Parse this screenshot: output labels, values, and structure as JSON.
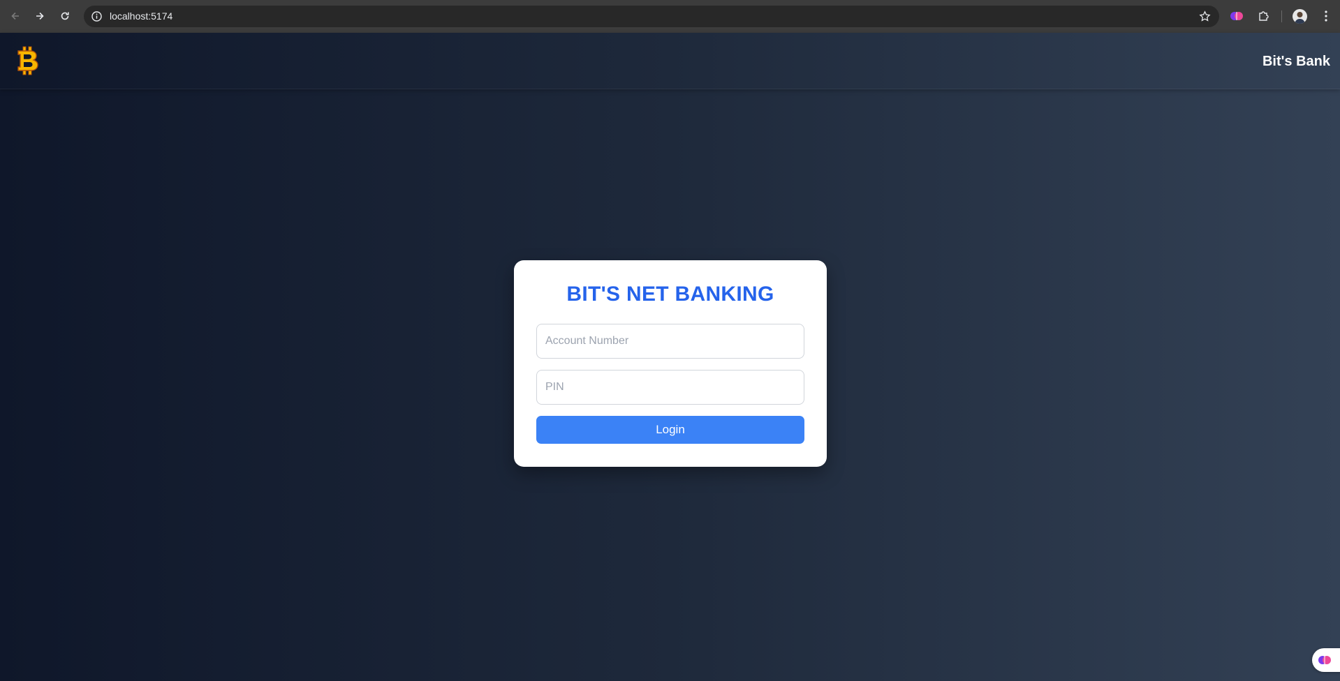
{
  "browser": {
    "url": "localhost:5174",
    "icons": [
      "back-icon",
      "forward-icon",
      "reload-icon",
      "site-info-icon",
      "bookmark-star-icon",
      "brain-extension-icon",
      "puzzle-extensions-icon",
      "profile-avatar",
      "menu-kebab-icon"
    ]
  },
  "header": {
    "logo_icon": "bitcoin-logo-icon",
    "brand": "Bit's Bank"
  },
  "login_card": {
    "title": "BIT'S NET BANKING",
    "account_placeholder": "Account Number",
    "account_value": "",
    "pin_placeholder": "PIN",
    "pin_value": "",
    "login_label": "Login"
  },
  "colors": {
    "accent": "#2563eb",
    "button": "#3b82f6",
    "background_start": "#0f172a",
    "background_end": "#334155",
    "logo": "#f7b500"
  }
}
